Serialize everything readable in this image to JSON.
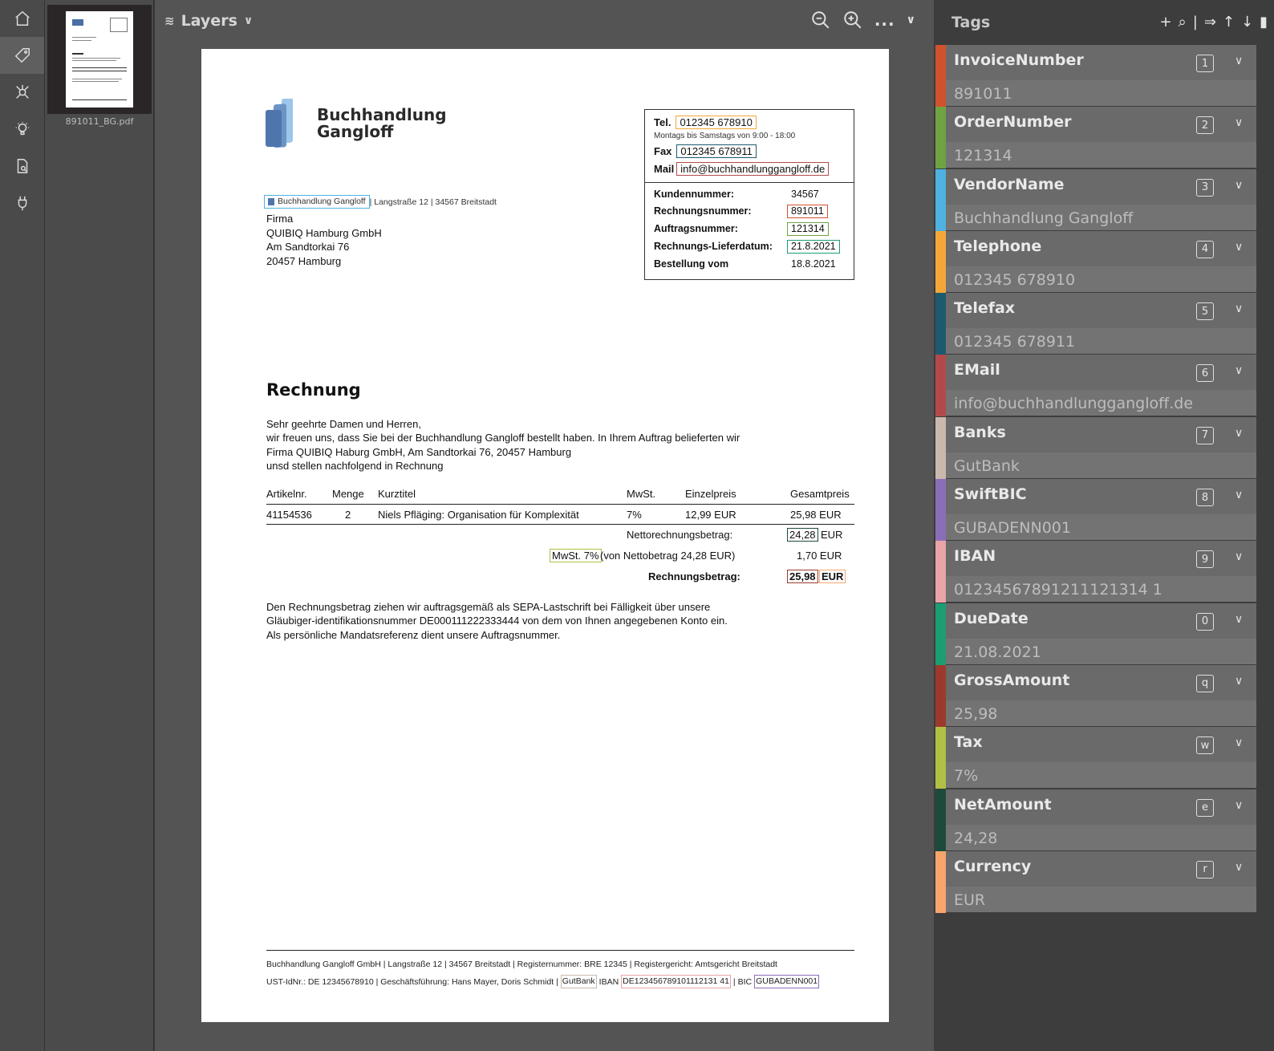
{
  "nav": {
    "items": [
      {
        "name": "home",
        "icon": "home-icon"
      },
      {
        "name": "tag",
        "icon": "tag-icon",
        "active": true
      },
      {
        "name": "connections",
        "icon": "network-icon"
      },
      {
        "name": "tips",
        "icon": "lightbulb-icon"
      },
      {
        "name": "documents",
        "icon": "document-search-icon"
      },
      {
        "name": "plugins",
        "icon": "plug-icon"
      }
    ]
  },
  "thumbnail": {
    "filename": "891011_BG.pdf"
  },
  "toolbar": {
    "layers_label": "Layers",
    "more_label": "...",
    "zoom_out_icon": "zoom-out-icon",
    "zoom_in_icon": "zoom-in-icon"
  },
  "document": {
    "logo_line1": "Buchhandlung",
    "logo_line2": "Gangloff",
    "tel_label": "Tel.",
    "tel_value": "012345 678910",
    "hours": "Montags bis Samstags von 9:00 - 18:00",
    "fax_label": "Fax",
    "fax_value": "012345 678911",
    "mail_label": "Mail",
    "mail_value": "info@buchhandlunggangloff.de",
    "kv": [
      {
        "label": "Kundennummer:",
        "value": "34567"
      },
      {
        "label": "Rechnungsnummer:",
        "value": "891011"
      },
      {
        "label": "Auftragsnummer:",
        "value": "121314"
      },
      {
        "label": "Rechnungs-Lieferdatum:",
        "value": "21.8.2021"
      },
      {
        "label": "Bestellung vom",
        "value": "18.8.2021"
      }
    ],
    "sender_name": "Buchhandlung Gangloff",
    "sender_address": " | Langstraße 12 | 34567 Breitstadt",
    "address": [
      "Firma",
      "QUIBIQ Hamburg GmbH",
      "Am Sandtorkai 76",
      "20457 Hamburg"
    ],
    "heading": "Rechnung",
    "body": [
      "Sehr geehrte Damen und Herren,",
      "wir freuen uns, dass Sie bei der Buchhandlung Gangloff bestellt haben. In Ihrem Auftrag belieferten wir",
      "Firma QUIBIQ Haburg GmbH, Am Sandtorkai 76, 20457 Hamburg",
      "unsd stellen nachfolgend in Rechnung"
    ],
    "table_headers": [
      "Artikelnr.",
      "Menge",
      "Kurztitel",
      "MwSt.",
      "Einzelpreis",
      "Gesamtpreis"
    ],
    "table_row": [
      "41154536",
      "2",
      "Niels Pfläging: Organisation für Komplexität",
      "7%",
      "12,99 EUR",
      "25,98 EUR"
    ],
    "net_label": "Nettorechnungsbetrag:",
    "net_value": "24,28",
    "net_currency": "EUR",
    "tax_tag": "MwSt. 7%",
    "tax_label": "(von Nettobetrag 24,28 EUR)",
    "tax_value": "1,70 EUR",
    "gross_label": "Rechnungsbetrag:",
    "gross_value": "25,98",
    "gross_currency": "EUR",
    "closing": [
      "Den Rechnungsbetrag ziehen wir auftragsgemäß als SEPA-Lastschrift bei Fälligkeit über unsere",
      "Gläubiger-identifikationsnummer DE000111222333444 von dem von Ihnen angegebenen Konto ein.",
      "Als persönliche Mandatsreferenz dient unsere Auftragsnummer."
    ],
    "footer_line1": "Buchhandlung Gangloff GmbH | Langstraße 12 | 34567 Breitstadt | Registernummer: BRE 12345 | Registergericht: Amtsgericht Breitstadt",
    "footer_line2_a": "UST-IdNr.: DE 12345678910 | Geschäftsführung: Hans Mayer, Doris Schmidt |",
    "footer_bank": "GutBank",
    "footer_iban_label": "IBAN",
    "footer_iban": "DE123456789101112131 41",
    "footer_bic_label": "| BIC",
    "footer_bic": "GUBADENN001"
  },
  "tags": {
    "title": "Tags",
    "tools": [
      "+",
      "⌕",
      "|",
      "⇒",
      "↑",
      "↓",
      "▮"
    ],
    "items": [
      {
        "name": "InvoiceNumber",
        "key": "1",
        "value": "891011",
        "color": "#d1522f"
      },
      {
        "name": "OrderNumber",
        "key": "2",
        "value": "121314",
        "color": "#6fa243"
      },
      {
        "name": "VendorName",
        "key": "3",
        "value": "Buchhandlung Gangloff",
        "color": "#4fb1e2"
      },
      {
        "name": "Telephone",
        "key": "4",
        "value": "012345 678910",
        "color": "#f4a63a"
      },
      {
        "name": "Telefax",
        "key": "5",
        "value": "012345 678911",
        "color": "#1d5a6e"
      },
      {
        "name": "EMail",
        "key": "6",
        "value": "info@buchhandlunggangloff.de",
        "color": "#b24a4b"
      },
      {
        "name": "Banks",
        "key": "7",
        "value": "GutBank",
        "color": "#c8b9ac"
      },
      {
        "name": "SwiftBIC",
        "key": "8",
        "value": "GUBADENN001",
        "color": "#8a6eb8"
      },
      {
        "name": "IBAN",
        "key": "9",
        "value": "01234567891211121314 1",
        "color": "#e8a4a6"
      },
      {
        "name": "DueDate",
        "key": "0",
        "value": "21.08.2021",
        "color": "#1e9c73"
      },
      {
        "name": "GrossAmount",
        "key": "q",
        "value": "25,98",
        "color": "#9b3a2c"
      },
      {
        "name": "Tax",
        "key": "w",
        "value": "7%",
        "color": "#b2bf45"
      },
      {
        "name": "NetAmount",
        "key": "e",
        "value": "24,28",
        "color": "#1c4a3c"
      },
      {
        "name": "Currency",
        "key": "r",
        "value": "EUR",
        "color": "#f7a56c"
      }
    ]
  }
}
